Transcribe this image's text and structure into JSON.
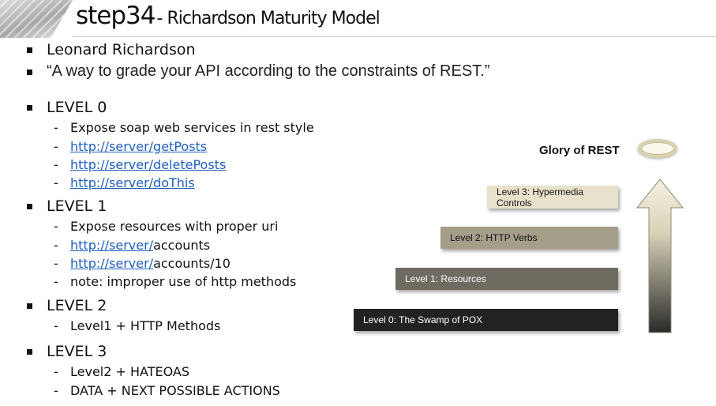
{
  "header": {
    "title_main": "step34",
    "title_sub": "- Richardson Maturity Model"
  },
  "bullets": [
    {
      "text": "Leonard Richardson"
    },
    {
      "text": "“A way to grade your API according to the constraints of REST.”"
    }
  ],
  "levels": [
    {
      "title": "LEVEL 0",
      "items": [
        {
          "text": "Expose soap web services in rest style"
        },
        {
          "link": "http://server/getPosts"
        },
        {
          "link": "http://server/deletePosts"
        },
        {
          "link": "http://server/doThis"
        }
      ]
    },
    {
      "title": "LEVEL 1",
      "items": [
        {
          "text": "Expose resources with proper uri"
        },
        {
          "link": "http://server/",
          "suffix": "accounts"
        },
        {
          "link": "http://server/",
          "suffix": "accounts/10"
        },
        {
          "text": "note: improper use of http methods"
        }
      ]
    },
    {
      "title": "LEVEL 2",
      "items": [
        {
          "text": "Level1 + HTTP Methods"
        }
      ]
    },
    {
      "title": "LEVEL 3",
      "items": [
        {
          "text": "Level2 + HATEOAS"
        },
        {
          "text": "DATA + NEXT POSSIBLE ACTIONS"
        }
      ]
    }
  ],
  "diagram": {
    "glory_label": "Glory of REST",
    "steps": [
      {
        "label": "Level 3: Hypermedia Controls",
        "color": "#e8e2cc"
      },
      {
        "label": "Level 2: HTTP Verbs",
        "color": "#a59f8a"
      },
      {
        "label": "Level 1: Resources",
        "color": "#6e6b60"
      },
      {
        "label": "Level 0: The Swamp of POX",
        "color": "#222222"
      }
    ],
    "arrow_colors": {
      "top": "#f5f1df",
      "bottom": "#2a2a2a"
    }
  }
}
